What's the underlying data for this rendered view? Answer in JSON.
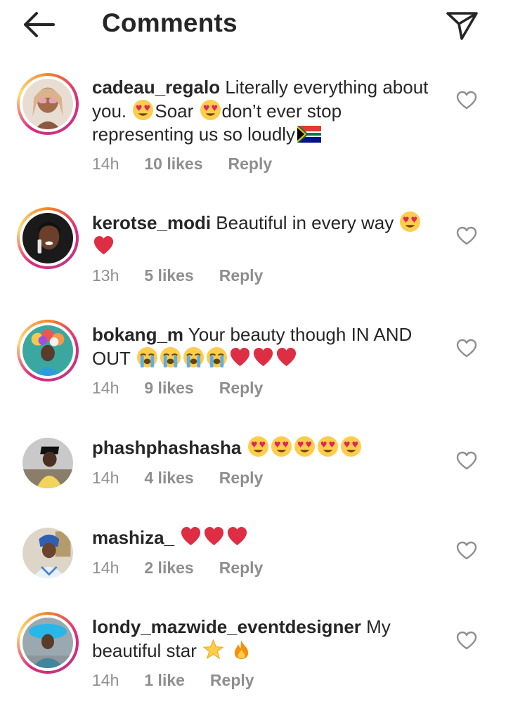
{
  "header": {
    "title": "Comments",
    "back_icon": "arrow-left-icon",
    "send_icon": "paper-plane-icon"
  },
  "colors": {
    "text": "#262626",
    "muted": "#8e8e8e",
    "story_ring": [
      "#f58529",
      "#dd2a7b",
      "#feda77"
    ]
  },
  "comments": [
    {
      "username": "cadeau_regalo",
      "text_parts": [
        " Literally everything about you. ",
        "Soar ",
        "don’t ever stop representing us so loudly"
      ],
      "emojis": [
        "heart-eyes",
        "heart-eyes",
        "south-africa-flag"
      ],
      "time": "14h",
      "likes": "10 likes",
      "reply": "Reply",
      "story_ring": true
    },
    {
      "username": "kerotse_modi",
      "text_parts": [
        " Beautiful in every way "
      ],
      "emojis": [
        "heart-eyes",
        "red-heart"
      ],
      "time": "13h",
      "likes": "5 likes",
      "reply": "Reply",
      "story_ring": true
    },
    {
      "username": "bokang_m",
      "text_parts": [
        " Your beauty though IN AND OUT "
      ],
      "emojis": [
        "loudly-crying",
        "loudly-crying",
        "loudly-crying",
        "loudly-crying",
        "red-heart",
        "red-heart",
        "red-heart"
      ],
      "time": "14h",
      "likes": "9 likes",
      "reply": "Reply",
      "story_ring": true
    },
    {
      "username": "phashphashasha",
      "text_parts": [
        " "
      ],
      "emojis": [
        "heart-eyes",
        "heart-eyes",
        "heart-eyes",
        "heart-eyes",
        "heart-eyes"
      ],
      "time": "14h",
      "likes": "4 likes",
      "reply": "Reply",
      "story_ring": false
    },
    {
      "username": "mashiza_",
      "text_parts": [
        " "
      ],
      "emojis": [
        "red-heart",
        "red-heart",
        "red-heart"
      ],
      "time": "14h",
      "likes": "2 likes",
      "reply": "Reply",
      "story_ring": false
    },
    {
      "username": "londy_mazwide_eventdesigner",
      "text_parts": [
        " My beautiful star "
      ],
      "emojis": [
        "star",
        "fire"
      ],
      "time": "14h",
      "likes": "1 like",
      "reply": "Reply",
      "story_ring": true
    }
  ],
  "like_icon": "heart-outline-icon"
}
